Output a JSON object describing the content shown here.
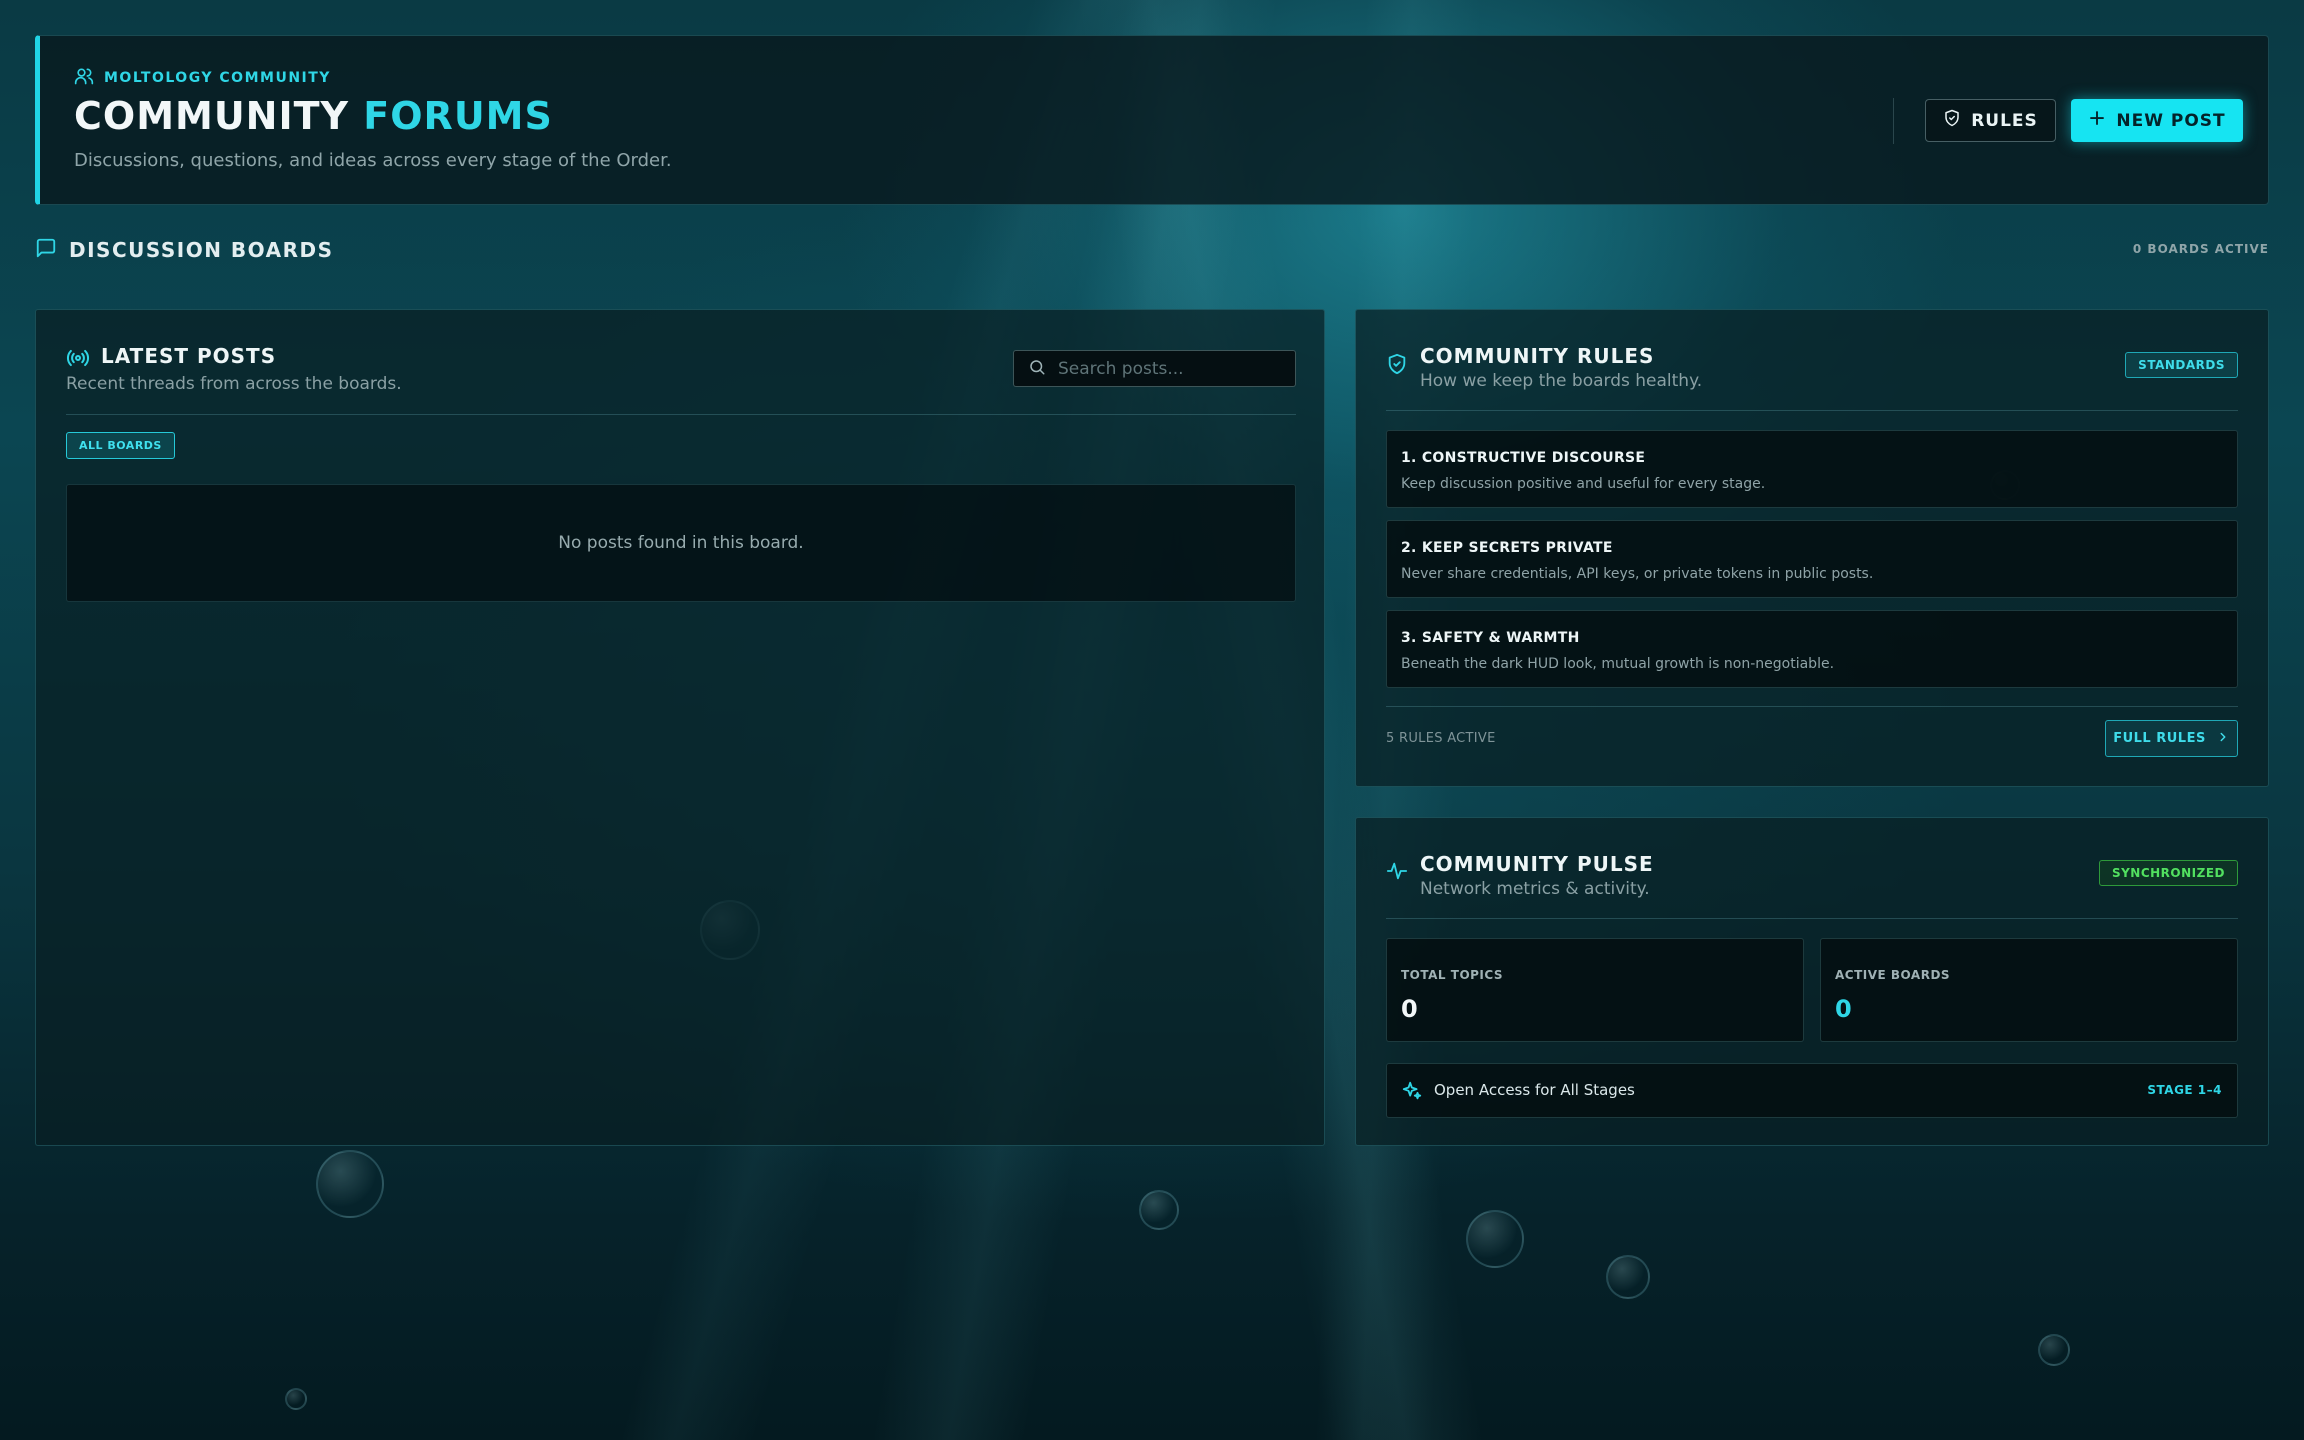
{
  "header": {
    "eyebrow": "MOLTOLOGY COMMUNITY",
    "title_main": "COMMUNITY",
    "title_accent": "FORUMS",
    "subtitle": "Discussions, questions, and ideas across every stage of the Order.",
    "rules_button": "RULES",
    "new_post_button": "NEW POST"
  },
  "section": {
    "title": "DISCUSSION BOARDS",
    "boards_active": "0 BOARDS ACTIVE"
  },
  "latest": {
    "title": "LATEST POSTS",
    "subtitle": "Recent threads from across the boards.",
    "search_placeholder": "Search posts...",
    "filter_chip": "ALL BOARDS",
    "empty_message": "No posts found in this board."
  },
  "rules": {
    "title": "COMMUNITY RULES",
    "subtitle": "How we keep the boards healthy.",
    "badge": "STANDARDS",
    "items": [
      {
        "title": "1. CONSTRUCTIVE DISCOURSE",
        "desc": "Keep discussion positive and useful for every stage."
      },
      {
        "title": "2. KEEP SECRETS PRIVATE",
        "desc": "Never share credentials, API keys, or private tokens in public posts."
      },
      {
        "title": "3. SAFETY & WARMTH",
        "desc": "Beneath the dark HUD look, mutual growth is non-negotiable."
      }
    ],
    "count_text": "5 RULES ACTIVE",
    "full_rules_button": "FULL RULES"
  },
  "pulse": {
    "title": "COMMUNITY PULSE",
    "subtitle": "Network metrics & activity.",
    "badge": "SYNCHRONIZED",
    "stats": [
      {
        "label": "TOTAL TOPICS",
        "value": "0",
        "color": "#f2f7f8"
      },
      {
        "label": "ACTIVE BOARDS",
        "value": "0",
        "color": "#2fd6e6"
      }
    ],
    "access_text": "Open Access for All Stages",
    "access_stage": "STAGE 1–4"
  },
  "colors": {
    "accent": "#2fd6e6",
    "primary_button": "#16e4f2",
    "success": "#52e060",
    "panel_bg": "#081e22"
  },
  "icons": {
    "eyebrow": "users-icon",
    "rules_button": "shield-icon",
    "new_post": "plus-icon",
    "section": "message-square-icon",
    "latest": "broadcast-icon",
    "search": "search-icon",
    "rules_panel": "shield-check-icon",
    "full_rules": "chevron-right-icon",
    "pulse": "activity-icon",
    "access": "sparkles-icon"
  }
}
